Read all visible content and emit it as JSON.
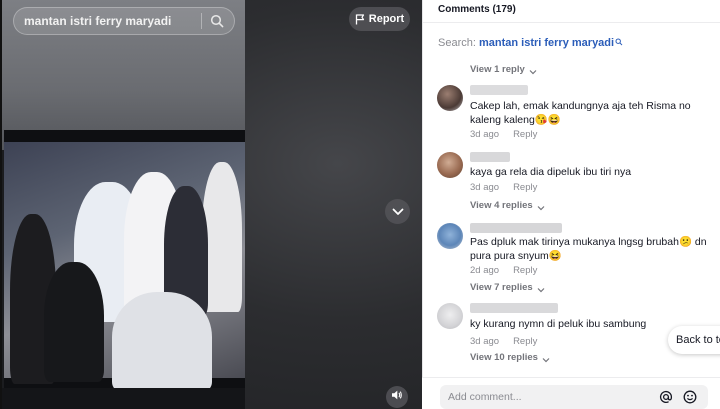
{
  "video": {
    "search_query": "mantan istri ferry maryadi",
    "report_label": "Report"
  },
  "comments_panel": {
    "header": "Comments (179)",
    "search_prefix": "Search: ",
    "search_term": "mantan istri ferry maryadi",
    "top_view_replies": "View 1 reply",
    "comments": [
      {
        "text": "Cakep lah, emak kandungnya aja teh Risma no kaleng kaleng😘😆",
        "time": "3d ago",
        "reply_label": "Reply",
        "view_replies": ""
      },
      {
        "text": "kaya ga rela dia dipeluk ibu tiri nya",
        "time": "3d ago",
        "reply_label": "Reply",
        "view_replies": "View 4 replies"
      },
      {
        "text": "Pas dpluk mak tirinya mukanya lngsg brubah😕 dn pura pura snyum😆",
        "time": "2d ago",
        "reply_label": "Reply",
        "view_replies": "View 7 replies"
      },
      {
        "text": "ky kurang nymn di peluk ibu sambung",
        "time": "3d ago",
        "reply_label": "Reply",
        "view_replies": "View 10 replies"
      }
    ],
    "back_to_top": "Back to top",
    "input_placeholder": "Add comment..."
  },
  "icons": [
    "search-icon",
    "flag-icon",
    "chevron-down-icon",
    "volume-icon",
    "at-mention-icon",
    "emoji-icon",
    "external-link-icon"
  ],
  "colors": {
    "link": "#2b5db9",
    "muted": "#8a8b91",
    "text": "#161823"
  }
}
